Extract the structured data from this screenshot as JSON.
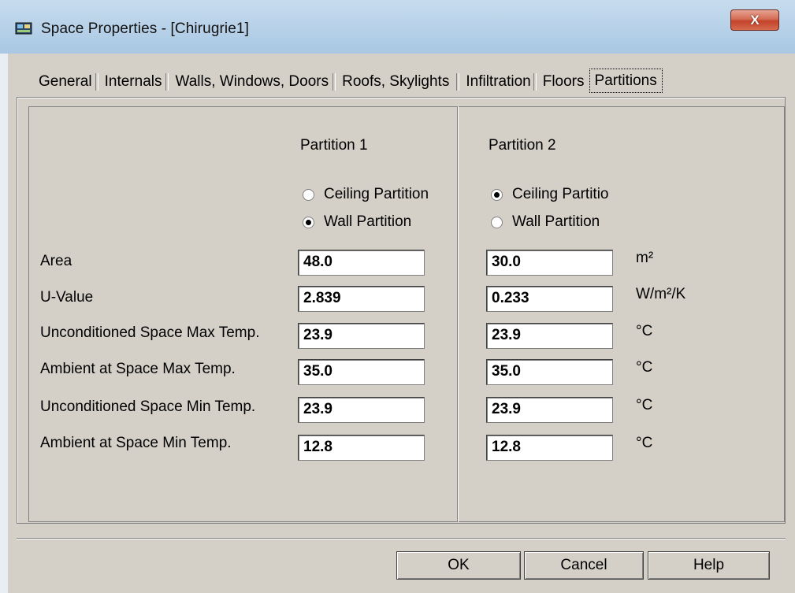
{
  "window": {
    "title": "Space Properties - [Chirugrie1]",
    "close_label": "X"
  },
  "tabs": [
    {
      "label": "General"
    },
    {
      "label": "Internals"
    },
    {
      "label": "Walls, Windows, Doors"
    },
    {
      "label": "Roofs, Skylights"
    },
    {
      "label": "Infiltration"
    },
    {
      "label": "Floors"
    },
    {
      "label": "Partitions",
      "active": true
    }
  ],
  "partitions": {
    "col1_header": "Partition 1",
    "col2_header": "Partition 2",
    "p1_ceiling_label": "Ceiling Partition",
    "p1_wall_label": "Wall Partition",
    "p1_selected": "Wall Partition",
    "p2_ceiling_label": "Ceiling Partitio",
    "p2_wall_label": "Wall Partition",
    "p2_selected": "Ceiling Partitio",
    "rows": [
      {
        "label": "Area",
        "p1": "48.0",
        "p2": "30.0",
        "unit": "m²"
      },
      {
        "label": "U-Value",
        "p1": "2.839",
        "p2": "0.233",
        "unit": "W/m²/K"
      },
      {
        "label": "Unconditioned Space Max Temp.",
        "p1": "23.9",
        "p2": "23.9",
        "unit": "°C"
      },
      {
        "label": "Ambient at Space Max Temp.",
        "p1": "35.0",
        "p2": "35.0",
        "unit": "°C"
      },
      {
        "label": "Unconditioned Space Min Temp.",
        "p1": "23.9",
        "p2": "23.9",
        "unit": "°C"
      },
      {
        "label": "Ambient at Space Min Temp.",
        "p1": "12.8",
        "p2": "12.8",
        "unit": "°C"
      }
    ]
  },
  "buttons": {
    "ok": "OK",
    "cancel": "Cancel",
    "help": "Help"
  }
}
